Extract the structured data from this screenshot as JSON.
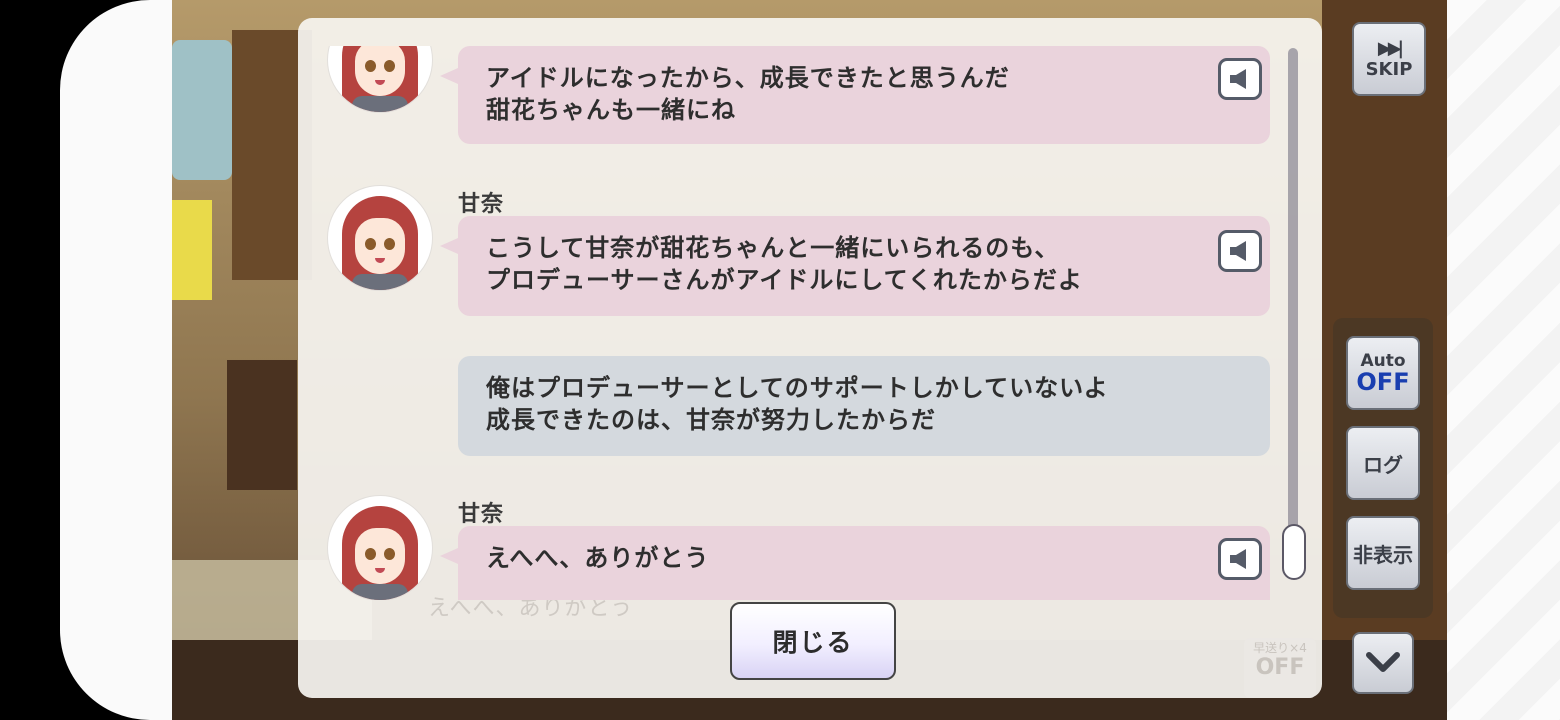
{
  "log": {
    "messages": [
      {
        "type": "character",
        "speaker": "",
        "lines": [
          "アイドルになったから、成長できたと思うんだ",
          "甜花ちゃんも一緒にね"
        ],
        "has_voice": true
      },
      {
        "type": "character",
        "speaker": "甘奈",
        "lines": [
          "こうして甘奈が甜花ちゃんと一緒にいられるのも、",
          "プロデューサーさんがアイドルにしてくれたからだよ"
        ],
        "has_voice": true
      },
      {
        "type": "producer",
        "speaker": "",
        "lines": [
          "俺はプロデューサーとしてのサポートしかしていないよ",
          "成長できたのは、甘奈が努力したからだ"
        ],
        "has_voice": false
      },
      {
        "type": "character",
        "speaker": "甘奈",
        "lines": [
          "えへへ、ありがとう"
        ],
        "has_voice": true
      }
    ],
    "close_label": "閉じる",
    "scroll_position": 0.95
  },
  "background": {
    "dialogue_text": "えへへ、ありがとう",
    "fast_forward_label": "早送り×4",
    "fast_forward_state": "OFF"
  },
  "controls": {
    "skip_label": "SKIP",
    "auto_label": "Auto",
    "auto_state": "OFF",
    "log_label": "ログ",
    "hide_label": "非表示"
  },
  "colors": {
    "character_bubble": "#ead3dc",
    "producer_bubble": "#d4d9de",
    "auto_off": "#1a3fb0"
  },
  "icons": {
    "voice": "speaker-icon",
    "skip": "fast-forward-icon",
    "menu": "chevron-down-icon"
  }
}
